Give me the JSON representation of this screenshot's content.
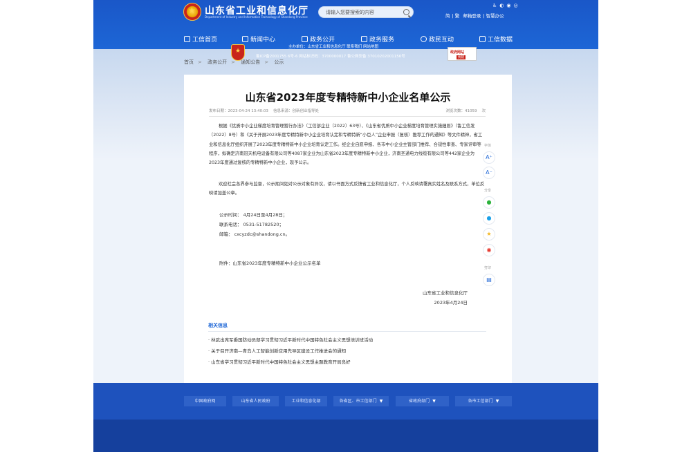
{
  "header": {
    "site_title": "山东省工业和信息化厅",
    "site_subtitle": "Department of Industry and Information Technology of Shandong Province",
    "search_placeholder": "请输入您要搜索的内容",
    "util_links": [
      "简",
      "繁",
      "邮箱登录",
      "智慧办公"
    ],
    "brand_color": "#1d66d6"
  },
  "nav": [
    "工信首页",
    "新闻中心",
    "政务公开",
    "政务服务",
    "政民互动",
    "工信数据"
  ],
  "breadcrumb": [
    "首页",
    "政务公开",
    "通知公告",
    "公示"
  ],
  "article": {
    "title": "山东省2023年度专精特新中小企业名单公示",
    "publish_label": "发布日期：",
    "publish_date": "2023-04-24 13:40:03",
    "source_label": "信息来源：",
    "source": "创新创业指导处",
    "views_label": "浏览次数：",
    "views": "41059",
    "views_unit": "次",
    "paragraph1": "根据《优质中小企业梯度培育管理暂行办法》（工信部企业〔2022〕63号）、《山东省优质中小企业梯度培育管理实施细则》（鲁工信发〔2022〕8号）和《关于开展2023年度专精特新中小企业培育认定和专精特新“小巨人”企业申报（复核）推荐工作的通知》等文件精神，省工业和信息化厅组织开展了2023年度专精特新中小企业培育认定工作。经企业自愿申报、各市中小企业主管部门推荐、合规性审查、专家评审等程序，拟确定济南冠天机电设备有限公司等4087家企业为山东省2023年度专精特新中小企业，济南圣通电力线缆有限公司等442家企业为2023年度通过复核的专精特新中小企业，现予公示。",
    "paragraph2": "欢迎社会各界参与监督，公示期间如对公示对象有异议，请以书面方式反馈省工业和信息化厅，个人反映请署真实姓名及联系方式，单位反映请加盖公章。",
    "contact_period": "公示时间：  4月24日至4月28日；",
    "contact_phone": "联系电话：  0531-51782520；",
    "contact_email": "邮箱：  cxcyzdc@shandong.cn。",
    "attachment": "附件：山东省2023年度专精特新中小企业公示名单",
    "sign_org": "山东省工业和信息化厅",
    "sign_date": "2023年4月24日"
  },
  "share": {
    "font_label": "字体",
    "font_up": "A⁺",
    "font_down": "A⁻",
    "share_label": "分享",
    "print_label": "打印"
  },
  "related": {
    "title": "相关信息",
    "items": [
      "林武出席军委国防动员部学习贯彻习近平新时代中国特色社会主义思想培训班活动",
      "关于召开济南—青岛人工智能创新应用先导区建设工作推进会的通知",
      "山东省学习贯彻习近平新时代中国特色社会主义思想主题教育开局良好"
    ]
  },
  "footer": {
    "links": [
      "中国政府网",
      "山东省人民政府",
      "工业和信息化部",
      "各省区、市工信部门",
      "省政府部门",
      "各市工信部门"
    ],
    "sponsor": "主办单位：山东省工业和信息化厅  联系我们  网站地图",
    "icp": "鲁ICP备2001755 6号-6  网站标识码：3700000017  鲁公网安备 37010202001156号",
    "gov_badge_top": "政府网站",
    "gov_badge_bottom": "找错"
  }
}
